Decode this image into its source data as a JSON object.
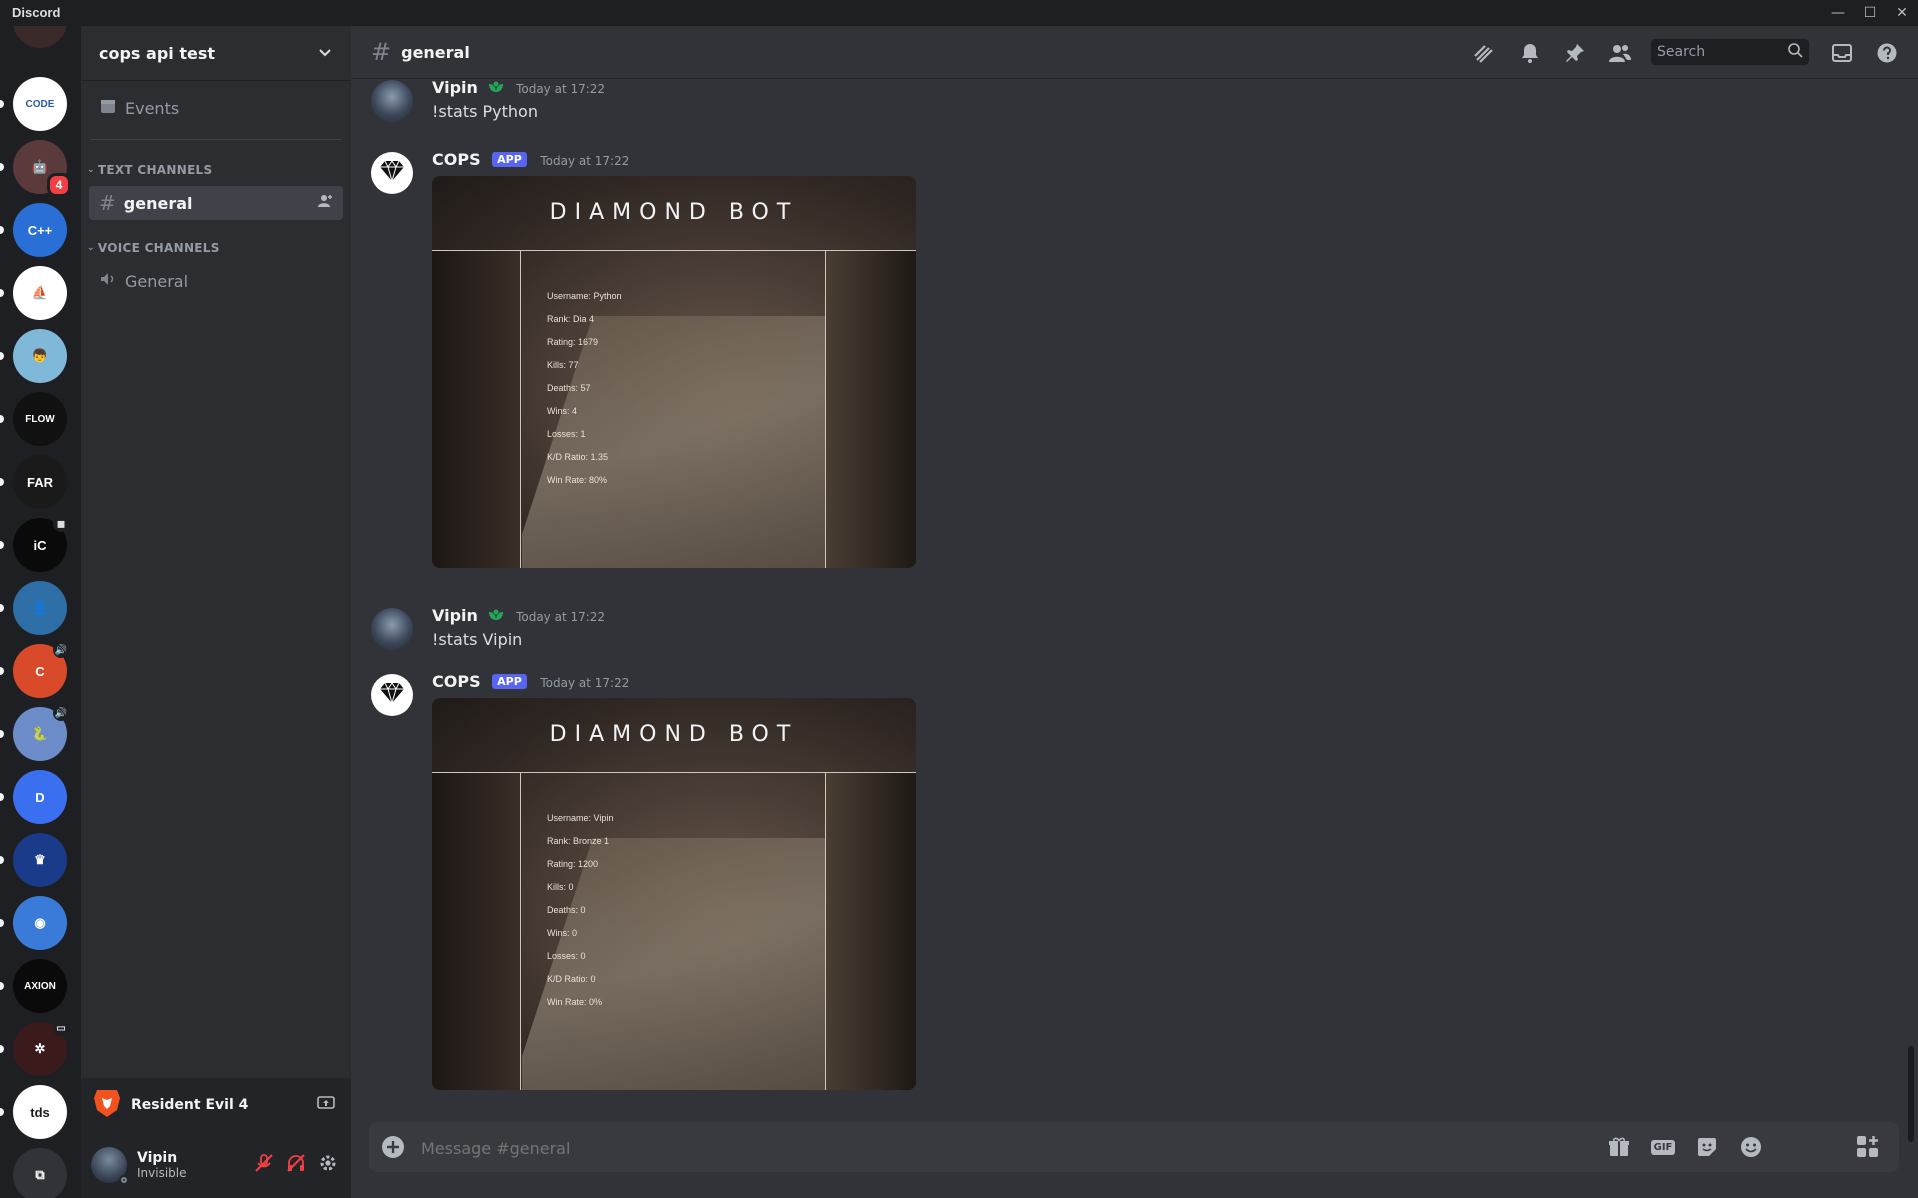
{
  "app": {
    "title": "Discord",
    "window_controls": [
      "—",
      "☐",
      "✕"
    ]
  },
  "servers": [
    {
      "label": "",
      "color": "#3a2a2a",
      "unread": true
    },
    {
      "label": "CODE",
      "color": "#ffffff",
      "text_color": "#2a5ca8",
      "unread": true
    },
    {
      "label": "🤖",
      "color": "#5a3a3a",
      "unread": true,
      "badge": "4"
    },
    {
      "label": "C++",
      "color": "#2a6fd6",
      "unread": true
    },
    {
      "label": "⛵",
      "color": "#ffffff",
      "text_color": "#1a1a1a",
      "unread": true
    },
    {
      "label": "👦",
      "color": "#7fb8d8",
      "unread": true
    },
    {
      "label": "FLOW",
      "color": "#111111",
      "unread": true
    },
    {
      "label": "FAR",
      "color": "#1a1a1a",
      "unread": true
    },
    {
      "label": "iC",
      "color": "#0a0a0a",
      "unread": true,
      "mini": "◼"
    },
    {
      "label": "👤",
      "color": "#2e6fa8",
      "unread": true
    },
    {
      "label": "C",
      "color": "#d84a2a",
      "unread": true,
      "mini": "🔊"
    },
    {
      "label": "🐍",
      "color": "#6b8cc8",
      "unread": true,
      "mini": "🔊"
    },
    {
      "label": "D",
      "color": "#3a6ff0",
      "unread": true
    },
    {
      "label": "♛",
      "color": "#1a3a8a",
      "unread": true
    },
    {
      "label": "◉",
      "color": "#3a7ad8",
      "unread": true
    },
    {
      "label": "AXION",
      "color": "#0a0a0a",
      "unread": true
    },
    {
      "label": "✲",
      "color": "#3a1a1a",
      "unread": true,
      "mini": "▭"
    },
    {
      "label": "tds",
      "color": "#ffffff",
      "text_color": "#1a1a1a",
      "unread": true
    },
    {
      "label": "⧉",
      "color": "#313338",
      "unread": false
    }
  ],
  "guild": {
    "name": "cops api test",
    "chevron": "⌄"
  },
  "channels": {
    "events_label": "Events",
    "text_category": "TEXT CHANNELS",
    "text": [
      {
        "name": "general",
        "active": true
      }
    ],
    "voice_category": "VOICE CHANNELS",
    "voice": [
      {
        "name": "General"
      }
    ]
  },
  "activity": {
    "game": "Resident Evil 4"
  },
  "user": {
    "name": "Vipin",
    "status": "Invisible"
  },
  "header": {
    "channel": "general",
    "search_placeholder": "Search"
  },
  "messages": [
    {
      "author": "Vipin",
      "app": false,
      "time": "Today at 17:22",
      "text": "!stats Python"
    },
    {
      "author": "COPS",
      "app": true,
      "app_label": "APP",
      "time": "Today at 17:22",
      "embed": {
        "title": "DIAMOND BOT",
        "stats": [
          "Username: Python",
          "Rank: Dia 4",
          "Rating: 1679",
          "Kills: 77",
          "Deaths: 57",
          "Wins: 4",
          "Losses: 1",
          "K/D Ratio: 1.35",
          "Win Rate: 80%"
        ]
      }
    },
    {
      "author": "Vipin",
      "app": false,
      "time": "Today at 17:22",
      "text": "!stats Vipin"
    },
    {
      "author": "COPS",
      "app": true,
      "app_label": "APP",
      "time": "Today at 17:22",
      "embed": {
        "title": "DIAMOND BOT",
        "stats": [
          "Username: Vipin",
          "Rank: Bronze 1",
          "Rating: 1200",
          "Kills: 0",
          "Deaths: 0",
          "Wins: 0",
          "Losses: 0",
          "K/D Ratio: 0",
          "Win Rate: 0%"
        ]
      }
    }
  ],
  "composer": {
    "placeholder": "Message #general",
    "gif_label": "GIF"
  },
  "colors": {
    "accent": "#5865f2",
    "online_green": "#23a55a",
    "danger": "#f23f43"
  }
}
